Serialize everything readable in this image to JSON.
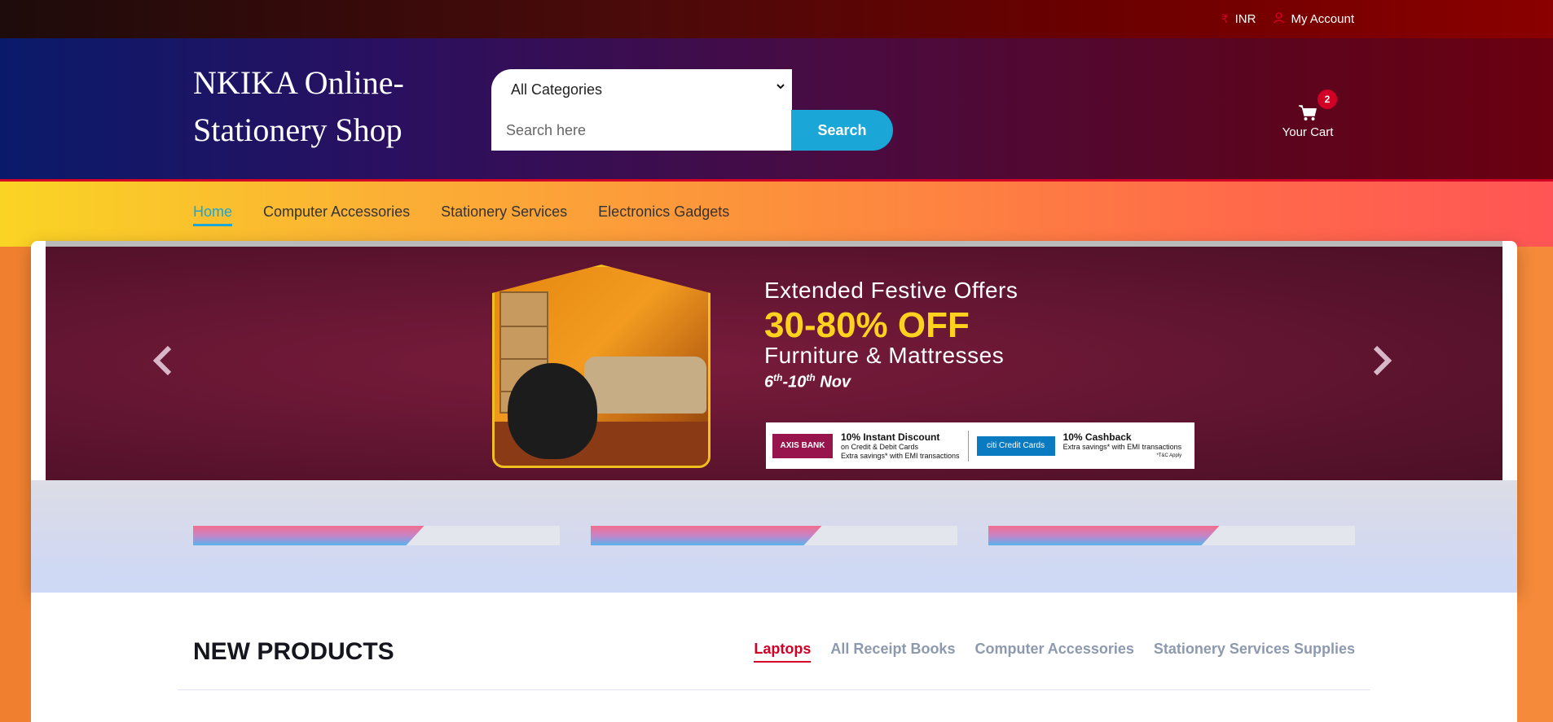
{
  "topbar": {
    "currency": "INR",
    "account": "My Account"
  },
  "header": {
    "logo": "NKIKA Online-Stationery Shop",
    "category_selected": "All Categories",
    "search_placeholder": "Search here",
    "search_button": "Search",
    "cart_count": "2",
    "cart_label": "Your Cart"
  },
  "nav": {
    "items": [
      "Home",
      "Computer Accessories",
      "Stationery Services",
      "Electronics Gadgets"
    ],
    "active": "Home"
  },
  "banner": {
    "line1": "Extended Festive Offers",
    "line2": "30-80% OFF",
    "line3": "Furniture & Mattresses",
    "date_start": "6",
    "date_start_sup": "th",
    "date_end": "-10",
    "date_end_sup": "th",
    "date_month": " Nov",
    "bank1_name": "AXIS BANK",
    "bank1_offer": "10% Instant Discount",
    "bank1_line1": "on Credit & Debit Cards",
    "bank1_line2": "Extra savings* with EMI transactions",
    "bank2_name": "citi Credit Cards",
    "bank2_offer": "10% Cashback",
    "bank2_line1": "Extra savings* with EMI transactions",
    "tnc": "*T&C Apply"
  },
  "slider_progress": [
    0.63,
    0.63,
    0.63
  ],
  "new_products": {
    "title": "NEW PRODUCTS",
    "tabs": [
      "Laptops",
      "All Receipt Books",
      "Computer Accessories",
      "Stationery Services Supplies"
    ],
    "active": "Laptops"
  },
  "colors": {
    "accent_red": "#d10024",
    "accent_blue": "#1aa6d6"
  }
}
